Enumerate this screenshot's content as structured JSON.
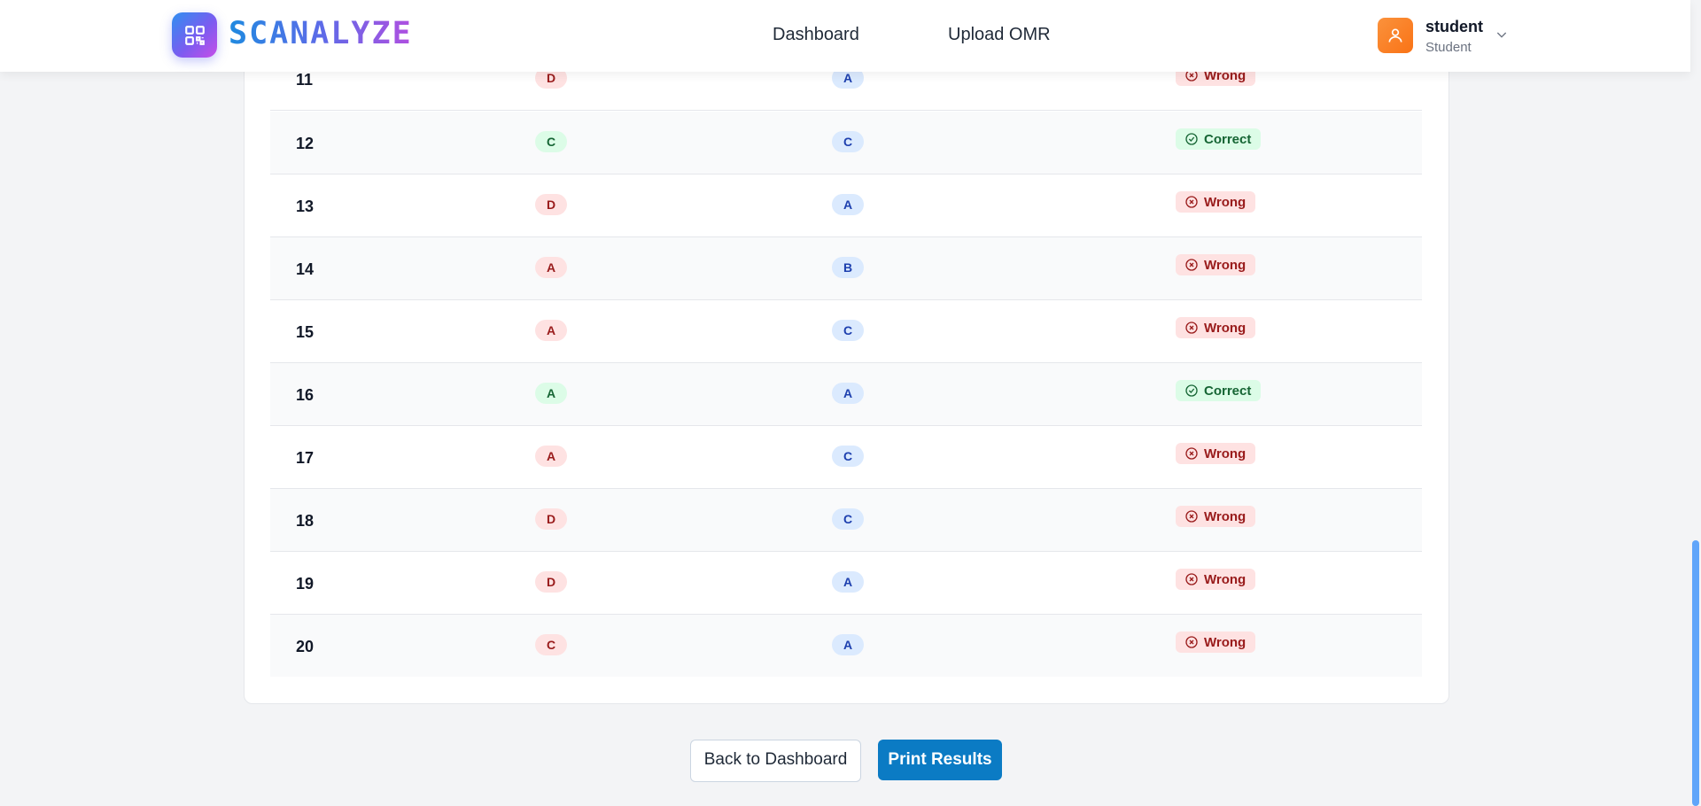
{
  "app": {
    "brand": "SCANALYZE",
    "logo_icon": "qr-code-icon",
    "accent": "#0b7bc4"
  },
  "nav": {
    "items": [
      {
        "label": "Dashboard"
      },
      {
        "label": "Upload OMR"
      }
    ]
  },
  "user": {
    "name": "student",
    "role": "Student",
    "avatar_icon": "user-icon",
    "menu_icon": "chevron-down-icon"
  },
  "results": {
    "rows": [
      {
        "q": "11",
        "your": "D",
        "key": "A",
        "status": "Wrong",
        "correct": false
      },
      {
        "q": "12",
        "your": "C",
        "key": "C",
        "status": "Correct",
        "correct": true
      },
      {
        "q": "13",
        "your": "D",
        "key": "A",
        "status": "Wrong",
        "correct": false
      },
      {
        "q": "14",
        "your": "A",
        "key": "B",
        "status": "Wrong",
        "correct": false
      },
      {
        "q": "15",
        "your": "A",
        "key": "C",
        "status": "Wrong",
        "correct": false
      },
      {
        "q": "16",
        "your": "A",
        "key": "A",
        "status": "Correct",
        "correct": true
      },
      {
        "q": "17",
        "your": "A",
        "key": "C",
        "status": "Wrong",
        "correct": false
      },
      {
        "q": "18",
        "your": "D",
        "key": "C",
        "status": "Wrong",
        "correct": false
      },
      {
        "q": "19",
        "your": "D",
        "key": "A",
        "status": "Wrong",
        "correct": false
      },
      {
        "q": "20",
        "your": "C",
        "key": "A",
        "status": "Wrong",
        "correct": false
      }
    ]
  },
  "actions": {
    "back_label": "Back to Dashboard",
    "print_label": "Print Results"
  },
  "colors": {
    "correct_bg": "#dcfce7",
    "correct_fg": "#166534",
    "wrong_bg": "#fee2e2",
    "wrong_fg": "#991b1b",
    "key_bg": "#dbeafe",
    "key_fg": "#1e40af"
  }
}
